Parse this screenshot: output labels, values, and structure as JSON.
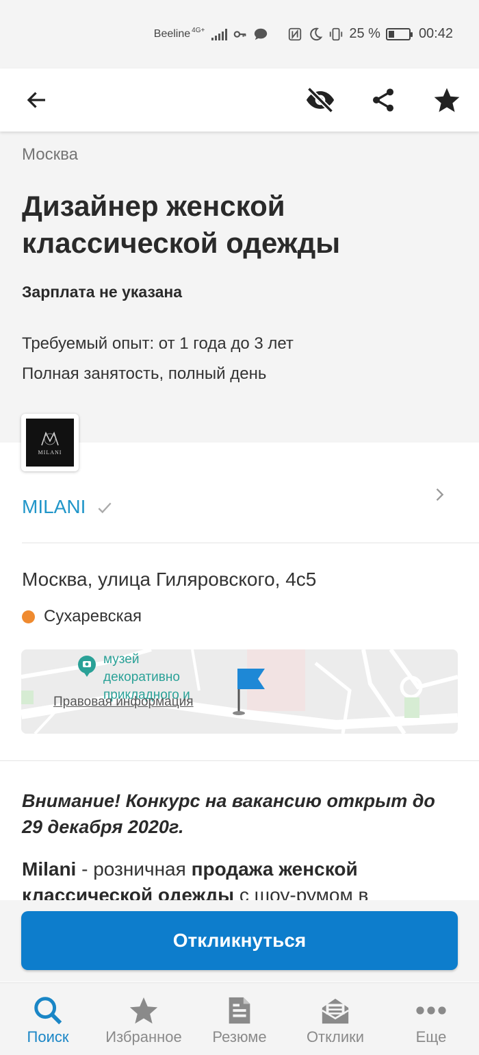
{
  "status_bar": {
    "carrier": "Beeline",
    "network": "4G+",
    "battery_percent": "25 %",
    "battery_level": 0.25,
    "time": "00:42"
  },
  "toolbar": {
    "back_icon": "arrow-left-icon",
    "hide_icon": "eye-off-icon",
    "share_icon": "share-icon",
    "favorite_icon": "star-icon"
  },
  "vacancy": {
    "city": "Москва",
    "title": "Дизайнер женской классической одежды",
    "salary": "Зарплата не указана",
    "experience": "Требуемый опыт: от 1 года до 3 лет",
    "employment": "Полная занятость, полный день"
  },
  "company": {
    "name": "MILANI",
    "logo_text": "MILANI",
    "verified_icon": "check-icon"
  },
  "location": {
    "address": "Москва, улица Гиляровского, 4с5",
    "metro": "Сухаревская",
    "metro_color": "#ef8a2f"
  },
  "map": {
    "poi_label_lines": [
      "музей",
      "декоративно",
      "прикладного и"
    ],
    "legal_link": "Правовая информация",
    "marker_color": "#1e88d6"
  },
  "description": {
    "notice": "Внимание! Конкурс на вакансию открыт до 29 декабря 2020г.",
    "p1_b1": "Milani",
    "p1_t1": " - розничная ",
    "p1_b2": "продажа женской классической одежды",
    "p1_t2": " с шоу-румом в"
  },
  "actions": {
    "respond_label": "Откликнуться",
    "accent_color": "#0d7dcc"
  },
  "bottom_nav": [
    {
      "label": "Поиск",
      "icon": "search-icon",
      "active": true
    },
    {
      "label": "Избранное",
      "icon": "star-icon",
      "active": false
    },
    {
      "label": "Резюме",
      "icon": "document-icon",
      "active": false
    },
    {
      "label": "Отклики",
      "icon": "envelope-icon",
      "active": false
    },
    {
      "label": "Еще",
      "icon": "more-icon",
      "active": false
    }
  ]
}
